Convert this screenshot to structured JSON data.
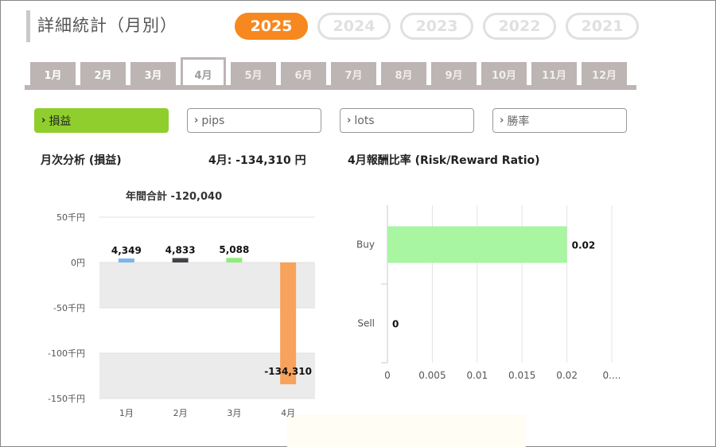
{
  "header": {
    "title": "詳細統計（月別）"
  },
  "years": [
    {
      "label": "2025",
      "active": true
    },
    {
      "label": "2024",
      "active": false
    },
    {
      "label": "2023",
      "active": false
    },
    {
      "label": "2022",
      "active": false
    },
    {
      "label": "2021",
      "active": false
    }
  ],
  "months": [
    {
      "label": "1月",
      "state": "past"
    },
    {
      "label": "2月",
      "state": "past"
    },
    {
      "label": "3月",
      "state": "past"
    },
    {
      "label": "4月",
      "state": "active"
    },
    {
      "label": "5月",
      "state": "future"
    },
    {
      "label": "6月",
      "state": "future"
    },
    {
      "label": "7月",
      "state": "future"
    },
    {
      "label": "8月",
      "state": "future"
    },
    {
      "label": "9月",
      "state": "future"
    },
    {
      "label": "10月",
      "state": "future"
    },
    {
      "label": "11月",
      "state": "future"
    },
    {
      "label": "12月",
      "state": "future"
    }
  ],
  "filters": [
    {
      "label": "損益",
      "active": true
    },
    {
      "label": "pips",
      "active": false
    },
    {
      "label": "lots",
      "active": false
    },
    {
      "label": "勝率",
      "active": false
    }
  ],
  "sections": {
    "left_title": "月次分析 (損益)",
    "month_summary": "4月:  -134,310 円",
    "right_title": "4月報酬比率 (Risk/Reward Ratio)",
    "yearly_total": "年間合計 -120,040"
  },
  "colors": {
    "accent_orange": "#f6881f",
    "filter_active": "#8fce2d",
    "tab_bg": "#bdb4b4"
  },
  "chart_data": [
    {
      "type": "bar",
      "title": "年間合計 -120,040",
      "categories": [
        "1月",
        "2月",
        "3月",
        "4月"
      ],
      "values": [
        4349,
        4833,
        5088,
        -134310
      ],
      "value_labels": [
        "4,349",
        "4,833",
        "5,088",
        "-134,310"
      ],
      "bar_colors": [
        "#7cb5ec",
        "#434348",
        "#90ed7d",
        "#f7a35c"
      ],
      "ylim": [
        -150000,
        50000
      ],
      "yticks": [
        50000,
        0,
        -50000,
        -100000,
        -150000
      ],
      "ytick_labels": [
        "50千円",
        "0円",
        "-50千円",
        "-100千円",
        "-150千円"
      ],
      "grid": "alternating bands"
    },
    {
      "type": "bar",
      "orientation": "horizontal",
      "title": "4月報酬比率 (Risk/Reward Ratio)",
      "categories": [
        "Buy",
        "Sell"
      ],
      "values": [
        0.02,
        0
      ],
      "value_labels": [
        "0.02",
        "0"
      ],
      "bar_color": "#a8f5a2",
      "xlim": [
        0,
        0.025
      ],
      "xticks": [
        0,
        0.005,
        0.01,
        0.015,
        0.02,
        0.025
      ],
      "xtick_labels": [
        "0",
        "0.005",
        "0.01",
        "0.015",
        "0.02",
        "0...."
      ],
      "grid": true
    }
  ]
}
